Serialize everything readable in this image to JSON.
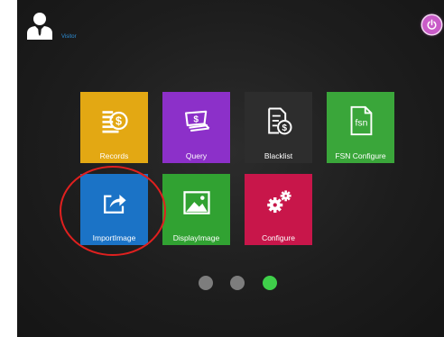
{
  "user": {
    "label": "Visitor",
    "icon": "user-avatar-icon"
  },
  "power": {
    "icon": "power-icon",
    "color": "#c95cc8"
  },
  "tiles": [
    {
      "label": "Records",
      "icon": "records-coin-icon",
      "color": "#e3a813"
    },
    {
      "label": "Query",
      "icon": "query-money-icon",
      "color": "#8c30c9"
    },
    {
      "label": "Blacklist",
      "icon": "blacklist-document-icon",
      "color": "#2d2d2d"
    },
    {
      "label": "FSN Configure",
      "icon": "fsn-file-icon",
      "color": "#3aa63a"
    },
    {
      "label": "ImportImage",
      "icon": "import-share-icon",
      "color": "#1b73c6"
    },
    {
      "label": "DisplayImage",
      "icon": "display-picture-icon",
      "color": "#31a232"
    },
    {
      "label": "Configure",
      "icon": "gears-icon",
      "color": "#c8164a"
    }
  ],
  "fsn_icon_text": "fsn",
  "pager": {
    "pages": 3,
    "current": 3,
    "active_color": "#3fcf4a",
    "inactive_color": "#7d7d7d"
  },
  "highlight": {
    "target": "ImportImage",
    "color": "#e0201f"
  }
}
